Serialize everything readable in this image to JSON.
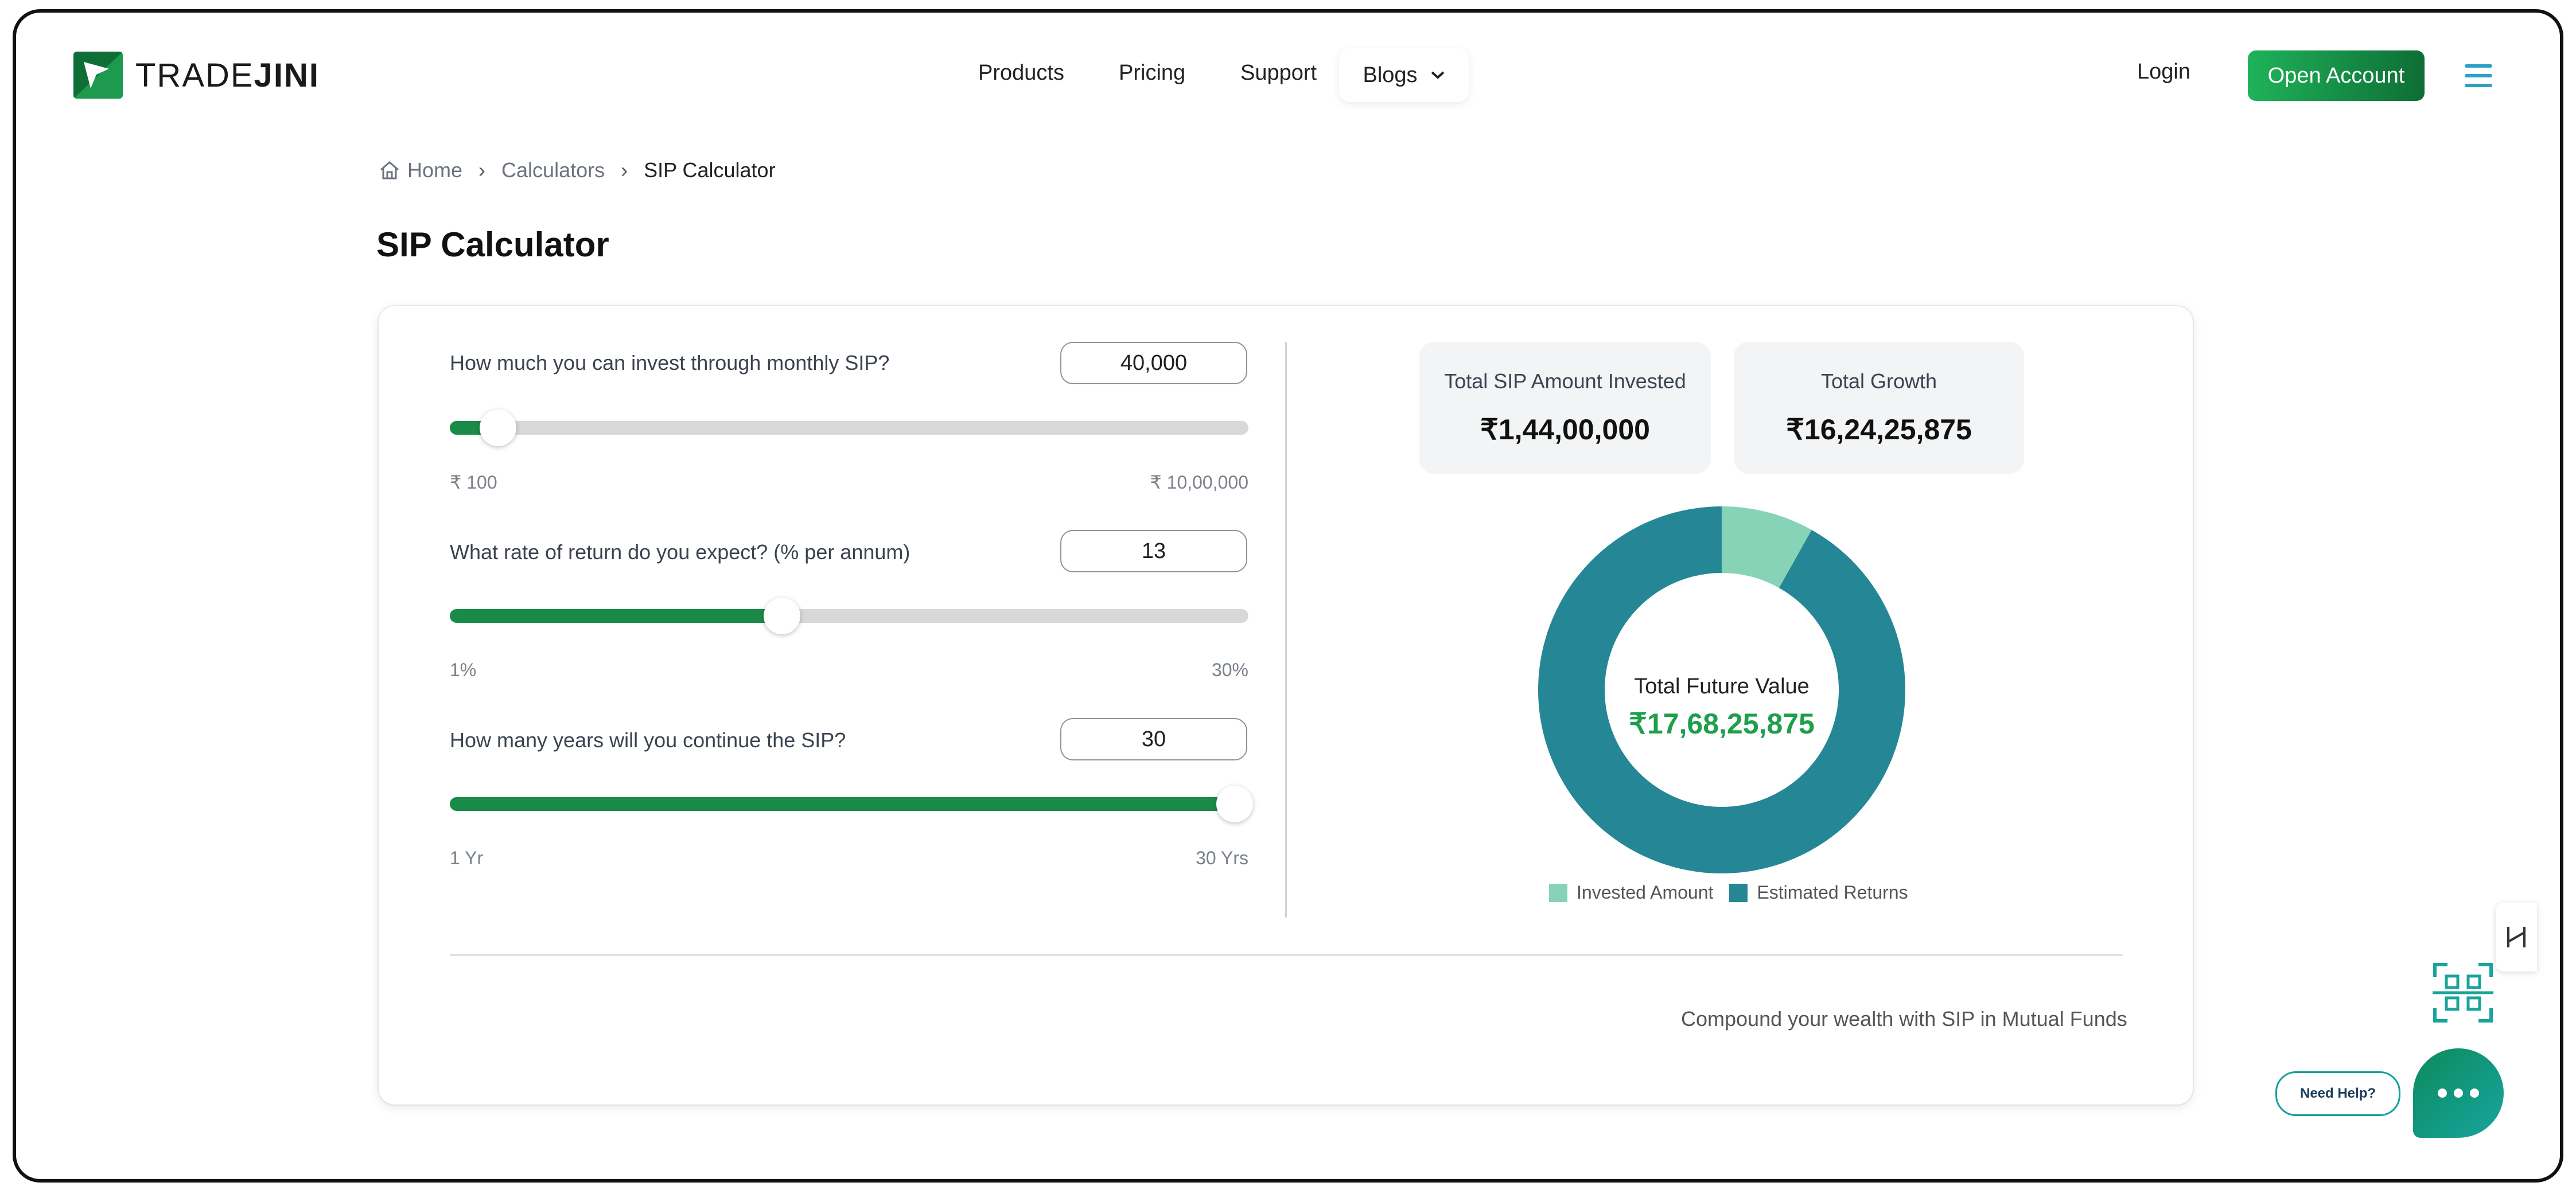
{
  "header": {
    "logo_text_light": "TRADE",
    "logo_text_bold": "JINI",
    "nav": [
      "Products",
      "Pricing",
      "Support"
    ],
    "blogs_label": "Blogs",
    "login_label": "Login",
    "open_account_label": "Open Account"
  },
  "breadcrumb": {
    "home": "Home",
    "calculators": "Calculators",
    "current": "SIP Calculator"
  },
  "page_title": "SIP Calculator",
  "calculator": {
    "monthly": {
      "label": "How much you can invest through monthly SIP?",
      "value": "40,000",
      "min_label": "₹ 100",
      "max_label": "₹ 10,00,000",
      "slider_fraction": 0.06
    },
    "rate": {
      "label": "What rate of return do you expect? (% per annum)",
      "value": "13",
      "min_label": "1%",
      "max_label": "30%",
      "slider_fraction": 0.416
    },
    "years": {
      "label": "How many years will you continue the SIP?",
      "value": "30",
      "min_label": "1 Yr",
      "max_label": "30 Yrs",
      "slider_fraction": 1.0
    }
  },
  "results": {
    "invested_title": "Total SIP Amount Invested",
    "invested_value": "₹1,44,00,000",
    "growth_title": "Total Growth",
    "growth_value": "₹16,24,25,875",
    "future_title": "Total Future Value",
    "future_value": "₹17,68,25,875"
  },
  "donut": {
    "invested_share": 0.0814,
    "invested_color": "#86d3b8",
    "returns_color": "#258795"
  },
  "legend": {
    "invested_label": "Invested Amount",
    "returns_label": "Estimated Returns"
  },
  "tagline": "Compound your wealth with SIP in Mutual Funds",
  "widgets": {
    "help_label": "Need Help?"
  },
  "colors": {
    "brand_green": "#1a8a47",
    "accent_green": "#1f9e4c",
    "teal": "#258795"
  }
}
